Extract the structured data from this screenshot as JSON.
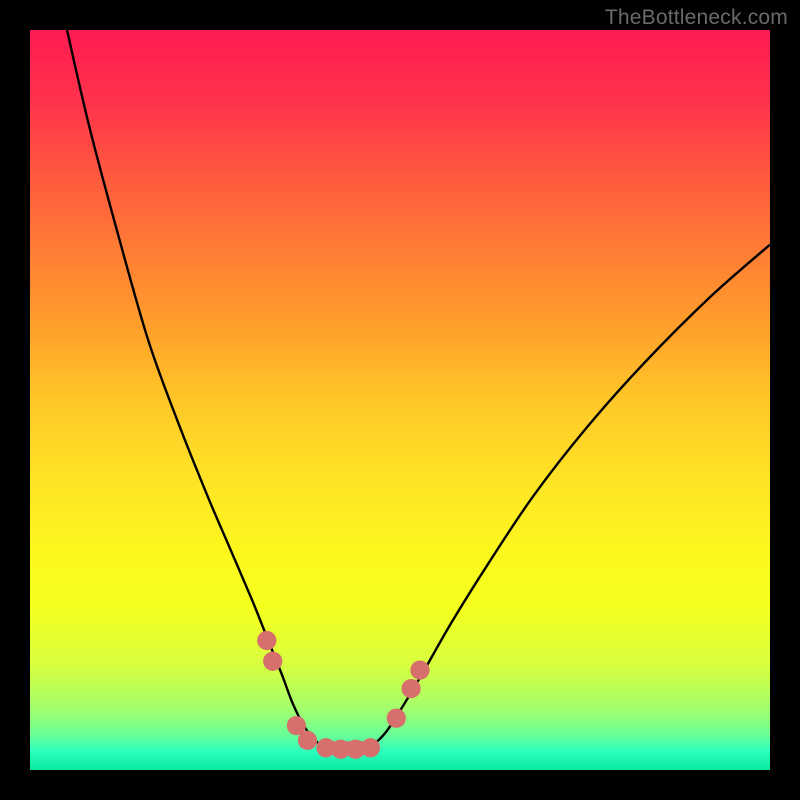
{
  "watermark": "TheBottleneck.com",
  "gradient": {
    "stops": [
      {
        "offset": 0.0,
        "color": "#ff1a52"
      },
      {
        "offset": 0.1,
        "color": "#ff344b"
      },
      {
        "offset": 0.2,
        "color": "#ff5a3e"
      },
      {
        "offset": 0.3,
        "color": "#ff7d34"
      },
      {
        "offset": 0.4,
        "color": "#ff9f2b"
      },
      {
        "offset": 0.5,
        "color": "#ffc728"
      },
      {
        "offset": 0.6,
        "color": "#ffe226"
      },
      {
        "offset": 0.7,
        "color": "#fdf71e"
      },
      {
        "offset": 0.78,
        "color": "#f4ff1e"
      },
      {
        "offset": 0.86,
        "color": "#d7ff41"
      },
      {
        "offset": 0.92,
        "color": "#a0ff6e"
      },
      {
        "offset": 0.955,
        "color": "#65ff9b"
      },
      {
        "offset": 0.975,
        "color": "#2dffbf"
      },
      {
        "offset": 1.0,
        "color": "#05e8a0"
      }
    ]
  },
  "chart_data": {
    "type": "line",
    "title": "",
    "xlabel": "",
    "ylabel": "",
    "xlim": [
      0,
      100
    ],
    "ylim": [
      0,
      100
    ],
    "series": [
      {
        "name": "left-curve",
        "x": [
          5,
          8,
          12,
          16,
          20,
          24,
          27,
          30,
          32,
          34,
          35.5,
          37,
          38.5,
          40
        ],
        "y": [
          100,
          87,
          72,
          58,
          47,
          37,
          30,
          23,
          18,
          13,
          9,
          6,
          4,
          3
        ]
      },
      {
        "name": "right-curve",
        "x": [
          46,
          48,
          50,
          53,
          57,
          62,
          68,
          75,
          83,
          92,
          100
        ],
        "y": [
          3,
          5,
          8,
          13,
          20,
          28,
          37,
          46,
          55,
          64,
          71
        ]
      }
    ],
    "flat_segment": {
      "x": [
        40,
        46
      ],
      "y": 3
    },
    "markers": {
      "color": "#d76f6c",
      "radius_pct": 1.3,
      "points": [
        {
          "x": 32.0,
          "y": 17.5
        },
        {
          "x": 32.8,
          "y": 14.7
        },
        {
          "x": 36.0,
          "y": 6.0
        },
        {
          "x": 37.5,
          "y": 4.0
        },
        {
          "x": 40.0,
          "y": 3.0
        },
        {
          "x": 42.0,
          "y": 2.8
        },
        {
          "x": 44.0,
          "y": 2.8
        },
        {
          "x": 46.0,
          "y": 3.0
        },
        {
          "x": 49.5,
          "y": 7.0
        },
        {
          "x": 51.5,
          "y": 11.0
        },
        {
          "x": 52.7,
          "y": 13.5
        }
      ]
    }
  }
}
